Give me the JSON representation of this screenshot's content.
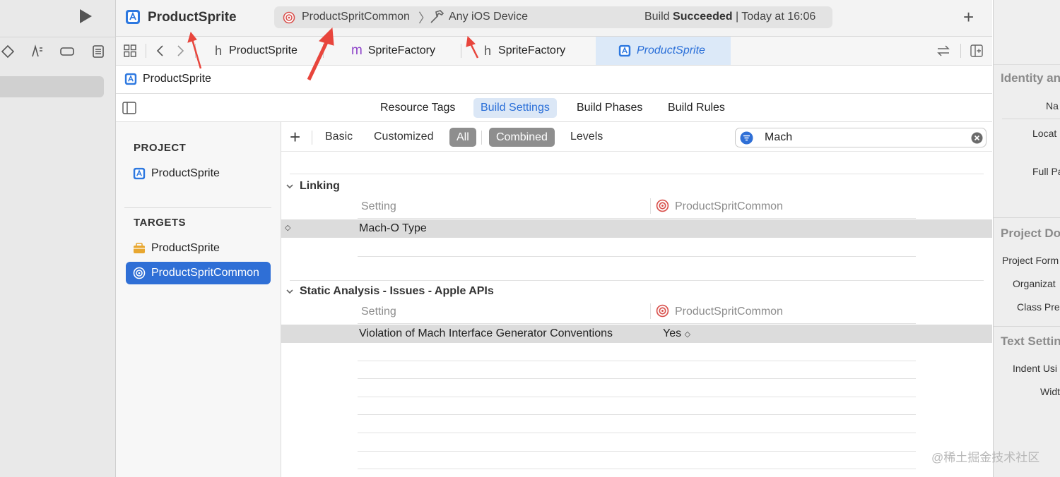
{
  "toolbar": {
    "project_name": "ProductSprite",
    "scheme": "ProductSpritCommon",
    "device": "Any iOS Device",
    "build_status_prefix": "Build ",
    "build_status_bold": "Succeeded",
    "build_status_suffix": " | Today at 16:06",
    "add_label": "+"
  },
  "tabs": [
    {
      "icon": "h",
      "label": "ProductSprite"
    },
    {
      "icon": "m",
      "label": "SpriteFactory"
    },
    {
      "icon": "h",
      "label": "SpriteFactory"
    },
    {
      "icon": "project-icon",
      "label": "ProductSprite"
    }
  ],
  "jumpbar": {
    "label": "ProductSprite"
  },
  "editor_tabs": [
    "Resource Tags",
    "Build Settings",
    "Build Phases",
    "Build Rules"
  ],
  "targets_panel": {
    "project_header": "PROJECT",
    "project_item": "ProductSprite",
    "targets_header": "TARGETS",
    "target_items": [
      "ProductSprite",
      "ProductSpritCommon"
    ]
  },
  "filter": {
    "add": "+",
    "basic": "Basic",
    "customized": "Customized",
    "all": "All",
    "combined": "Combined",
    "levels": "Levels",
    "search_value": "Mach"
  },
  "sections": [
    {
      "title": "Linking",
      "setting_col": "Setting",
      "target_col": "ProductSpritCommon",
      "rows": [
        {
          "name": "Mach-O Type",
          "value": ""
        }
      ]
    },
    {
      "title": "Static Analysis - Issues - Apple APIs",
      "setting_col": "Setting",
      "target_col": "ProductSpritCommon",
      "rows": [
        {
          "name": "Violation of Mach Interface Generator Conventions",
          "value": "Yes"
        }
      ]
    }
  ],
  "inspector": {
    "identity_header": "Identity an",
    "name_label": "Na",
    "location_label": "Locat",
    "fullpath_label": "Full Pa",
    "project_doc_header": "Project Do",
    "project_format_label": "Project Form",
    "organization_label": "Organizat",
    "class_prefix_label": "Class Pre",
    "text_settings_header": "Text Settin",
    "indent_label": "Indent Usi",
    "width_label": "Widt"
  },
  "watermark": "@稀土掘金技术社区",
  "colors": {
    "accent": "#2f6fd6",
    "annotation_arrow": "#e8453c"
  }
}
